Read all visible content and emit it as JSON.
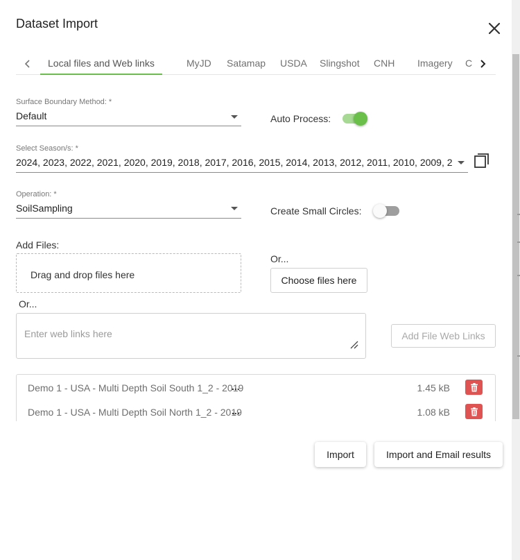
{
  "dialog": {
    "title": "Dataset Import"
  },
  "tabs": [
    {
      "label": "Local files and Web links",
      "active": true
    },
    {
      "label": "MyJD",
      "active": false
    },
    {
      "label": "Satamap",
      "active": false
    },
    {
      "label": "USDA",
      "active": false
    },
    {
      "label": "Slingshot",
      "active": false
    },
    {
      "label": "CNH",
      "active": false
    },
    {
      "label": "Imagery",
      "active": false
    },
    {
      "label": "Cotto",
      "active": false
    }
  ],
  "surface_boundary": {
    "label": "Surface Boundary Method: *",
    "value": "Default"
  },
  "auto_process": {
    "label": "Auto Process:",
    "on": true
  },
  "seasons": {
    "label": "Select Season/s: *",
    "value": "2024, 2023, 2022, 2021, 2020, 2019, 2018, 2017, 2016, 2015, 2014, 2013, 2012, 2011, 2010, 2009, 20..."
  },
  "operation": {
    "label": "Operation: *",
    "value": "SoilSampling"
  },
  "small_circles": {
    "label": "Create Small Circles:",
    "on": false
  },
  "add_files": {
    "label": "Add Files:",
    "dropzone_text": "Drag and drop files here",
    "or_text_1": "Or...",
    "choose_label": "Choose files here",
    "or_text_2": "Or...",
    "weblinks_placeholder": "Enter web links here",
    "add_links_label": "Add File Web Links"
  },
  "files": [
    {
      "name": "Demo 1 - USA - Multi Depth Soil South 1_2 - 2019 ",
      "ellipsis": "...",
      "size": "1.45 kB"
    },
    {
      "name": "Demo 1 - USA - Multi Depth Soil North 1_2 - 2019 -",
      "ellipsis": "...",
      "size": "1.08 kB"
    }
  ],
  "actions": {
    "import_label": "Import",
    "import_email_label": "Import and Email results"
  },
  "colors": {
    "accent_green": "#6abf4b",
    "delete_red": "#e05353"
  }
}
